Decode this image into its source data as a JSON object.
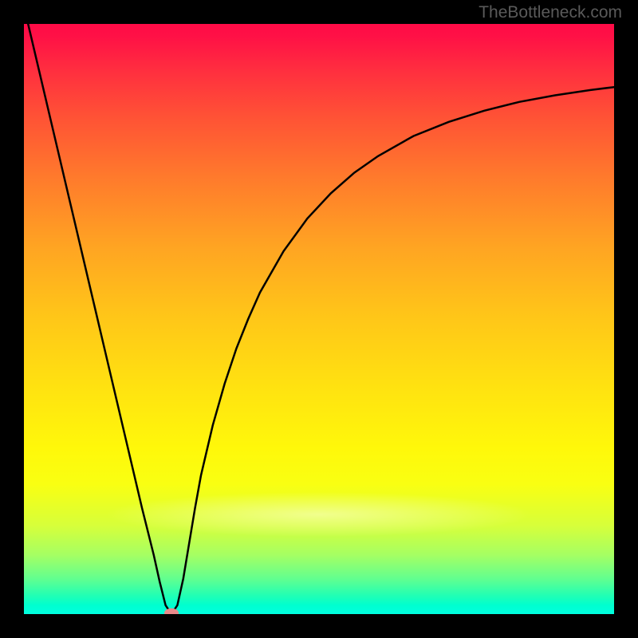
{
  "watermark": "TheBottleneck.com",
  "chart_data": {
    "type": "line",
    "title": "",
    "xlabel": "",
    "ylabel": "",
    "xlim": [
      0,
      100
    ],
    "ylim": [
      0,
      100
    ],
    "series": [
      {
        "name": "curve",
        "x": [
          0,
          2,
          4,
          6,
          8,
          10,
          12,
          14,
          16,
          18,
          20,
          22,
          23,
          24,
          25,
          26,
          27,
          28,
          29,
          30,
          32,
          34,
          36,
          38,
          40,
          44,
          48,
          52,
          56,
          60,
          66,
          72,
          78,
          84,
          90,
          96,
          100
        ],
        "y": [
          103,
          94.5,
          86,
          77.5,
          69,
          60.5,
          52,
          43.5,
          35,
          26.5,
          18,
          10,
          5.5,
          1.5,
          0,
          1.5,
          6,
          12,
          18,
          23.5,
          32,
          39,
          45,
          50,
          54.5,
          61.5,
          67,
          71.3,
          74.8,
          77.6,
          81,
          83.4,
          85.3,
          86.8,
          87.9,
          88.8,
          89.3
        ]
      }
    ],
    "marker": {
      "x": 25,
      "y": 0,
      "color": "#e88a8a"
    },
    "annotations": [],
    "gradient_stops": [
      {
        "pos": 0,
        "color": "#ff0b47"
      },
      {
        "pos": 50,
        "color": "#ffc718"
      },
      {
        "pos": 78,
        "color": "#f9ff12"
      },
      {
        "pos": 100,
        "color": "#00ffe0"
      }
    ]
  }
}
